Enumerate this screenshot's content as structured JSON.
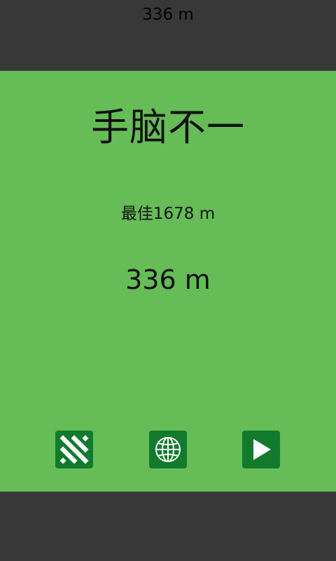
{
  "header": {
    "current_distance": "336 m"
  },
  "game": {
    "title": "手脑不一",
    "best_label": "最佳1678 m",
    "current_distance": "336 m"
  },
  "buttons": [
    {
      "name": "grid",
      "icon": "checkerboard-icon"
    },
    {
      "name": "globe",
      "icon": "globe-icon"
    },
    {
      "name": "play",
      "icon": "play-icon"
    }
  ],
  "colors": {
    "background_dark": "#383838",
    "panel_green": "#66bd57",
    "button_green": "#127a2c"
  }
}
